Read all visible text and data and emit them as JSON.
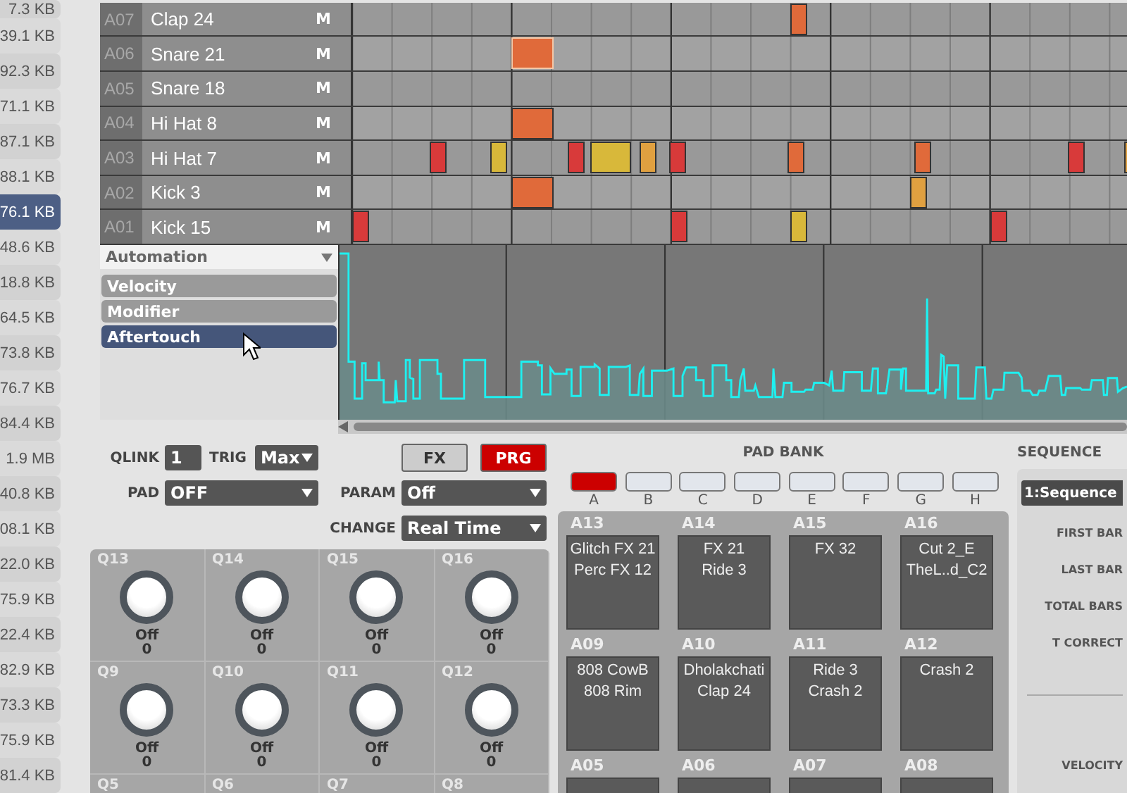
{
  "file_list": [
    {
      "size": "7.3 KB",
      "selected": false
    },
    {
      "size": "39.1 KB",
      "selected": false
    },
    {
      "size": "92.3 KB",
      "selected": false
    },
    {
      "size": "71.1 KB",
      "selected": false
    },
    {
      "size": "87.1 KB",
      "selected": false
    },
    {
      "size": "88.1 KB",
      "selected": false
    },
    {
      "size": "76.1 KB",
      "selected": true
    },
    {
      "size": "48.6 KB",
      "selected": false
    },
    {
      "size": "18.8 KB",
      "selected": false
    },
    {
      "size": "64.5 KB",
      "selected": false
    },
    {
      "size": "73.8 KB",
      "selected": false
    },
    {
      "size": "76.7 KB",
      "selected": false
    },
    {
      "size": "84.4 KB",
      "selected": false
    },
    {
      "size": "1.9 MB",
      "selected": false
    },
    {
      "size": "40.8 KB",
      "selected": false
    },
    {
      "size": "08.1 KB",
      "selected": false
    },
    {
      "size": "22.0 KB",
      "selected": false
    },
    {
      "size": "75.9 KB",
      "selected": false
    },
    {
      "size": "22.4 KB",
      "selected": false
    },
    {
      "size": "82.9 KB",
      "selected": false
    },
    {
      "size": "73.3 KB",
      "selected": false
    },
    {
      "size": "75.9 KB",
      "selected": false
    },
    {
      "size": "81.4 KB",
      "selected": false
    }
  ],
  "tracks": [
    {
      "id": "A07",
      "name": "Clap 24",
      "mute": "M"
    },
    {
      "id": "A06",
      "name": "Snare 21",
      "mute": "M"
    },
    {
      "id": "A05",
      "name": "Snare 18",
      "mute": "M"
    },
    {
      "id": "A04",
      "name": "Hi Hat 8",
      "mute": "M"
    },
    {
      "id": "A03",
      "name": "Hi Hat 7",
      "mute": "M"
    },
    {
      "id": "A02",
      "name": "Kick 3",
      "mute": "M"
    },
    {
      "id": "A01",
      "name": "Kick 15",
      "mute": "M"
    }
  ],
  "automation": {
    "title": "Automation",
    "lanes": [
      {
        "label": "Velocity",
        "selected": false
      },
      {
        "label": "Modifier",
        "selected": false
      },
      {
        "label": "Aftertouch",
        "selected": true
      }
    ]
  },
  "controls": {
    "qlink": {
      "label": "QLINK",
      "value": "1"
    },
    "trig": {
      "label": "TRIG",
      "value": "Max"
    },
    "pad": {
      "label": "PAD",
      "value": "OFF"
    },
    "param": {
      "label": "PARAM",
      "value": "Off"
    },
    "change": {
      "label": "CHANGE",
      "value": "Real Time"
    },
    "modes": [
      {
        "label": "FX",
        "selected": false
      },
      {
        "label": "PRG",
        "selected": true
      }
    ]
  },
  "knobs": [
    {
      "label": "Q13",
      "name": "Off",
      "value": "0"
    },
    {
      "label": "Q14",
      "name": "Off",
      "value": "0"
    },
    {
      "label": "Q15",
      "name": "Off",
      "value": "0"
    },
    {
      "label": "Q16",
      "name": "Off",
      "value": "0"
    },
    {
      "label": "Q9",
      "name": "Off",
      "value": "0"
    },
    {
      "label": "Q10",
      "name": "Off",
      "value": "0"
    },
    {
      "label": "Q11",
      "name": "Off",
      "value": "0"
    },
    {
      "label": "Q12",
      "name": "Off",
      "value": "0"
    },
    {
      "label": "Q5"
    },
    {
      "label": "Q6"
    },
    {
      "label": "Q7"
    },
    {
      "label": "Q8"
    }
  ],
  "pad_bank": {
    "title": "PAD BANK",
    "banks": [
      {
        "letter": "A",
        "selected": true
      },
      {
        "letter": "B",
        "selected": false
      },
      {
        "letter": "C",
        "selected": false
      },
      {
        "letter": "D",
        "selected": false
      },
      {
        "letter": "E",
        "selected": false
      },
      {
        "letter": "F",
        "selected": false
      },
      {
        "letter": "G",
        "selected": false
      },
      {
        "letter": "H",
        "selected": false
      }
    ],
    "pads": [
      {
        "id": "A13",
        "lines": [
          "Glitch FX 21",
          "Perc FX 12"
        ]
      },
      {
        "id": "A14",
        "lines": [
          "FX 21",
          "Ride 3"
        ]
      },
      {
        "id": "A15",
        "lines": [
          "FX 32"
        ]
      },
      {
        "id": "A16",
        "lines": [
          "Cut 2_E",
          "TheL..d_C2"
        ]
      },
      {
        "id": "A09",
        "lines": [
          "808 CowB",
          "808 Rim"
        ]
      },
      {
        "id": "A10",
        "lines": [
          "Dholakchati",
          "Clap 24"
        ]
      },
      {
        "id": "A11",
        "lines": [
          "Ride 3",
          "Crash 2"
        ]
      },
      {
        "id": "A12",
        "lines": [
          "Crash 2"
        ]
      },
      {
        "id": "A05"
      },
      {
        "id": "A06"
      },
      {
        "id": "A07"
      },
      {
        "id": "A08"
      }
    ]
  },
  "sequence": {
    "title": "SEQUENCE",
    "value": "1:Sequence",
    "fields": [
      "FIRST BAR",
      "LAST BAR",
      "TOTAL BARS",
      "T CORRECT"
    ],
    "velocity_label": "VELOCITY"
  }
}
